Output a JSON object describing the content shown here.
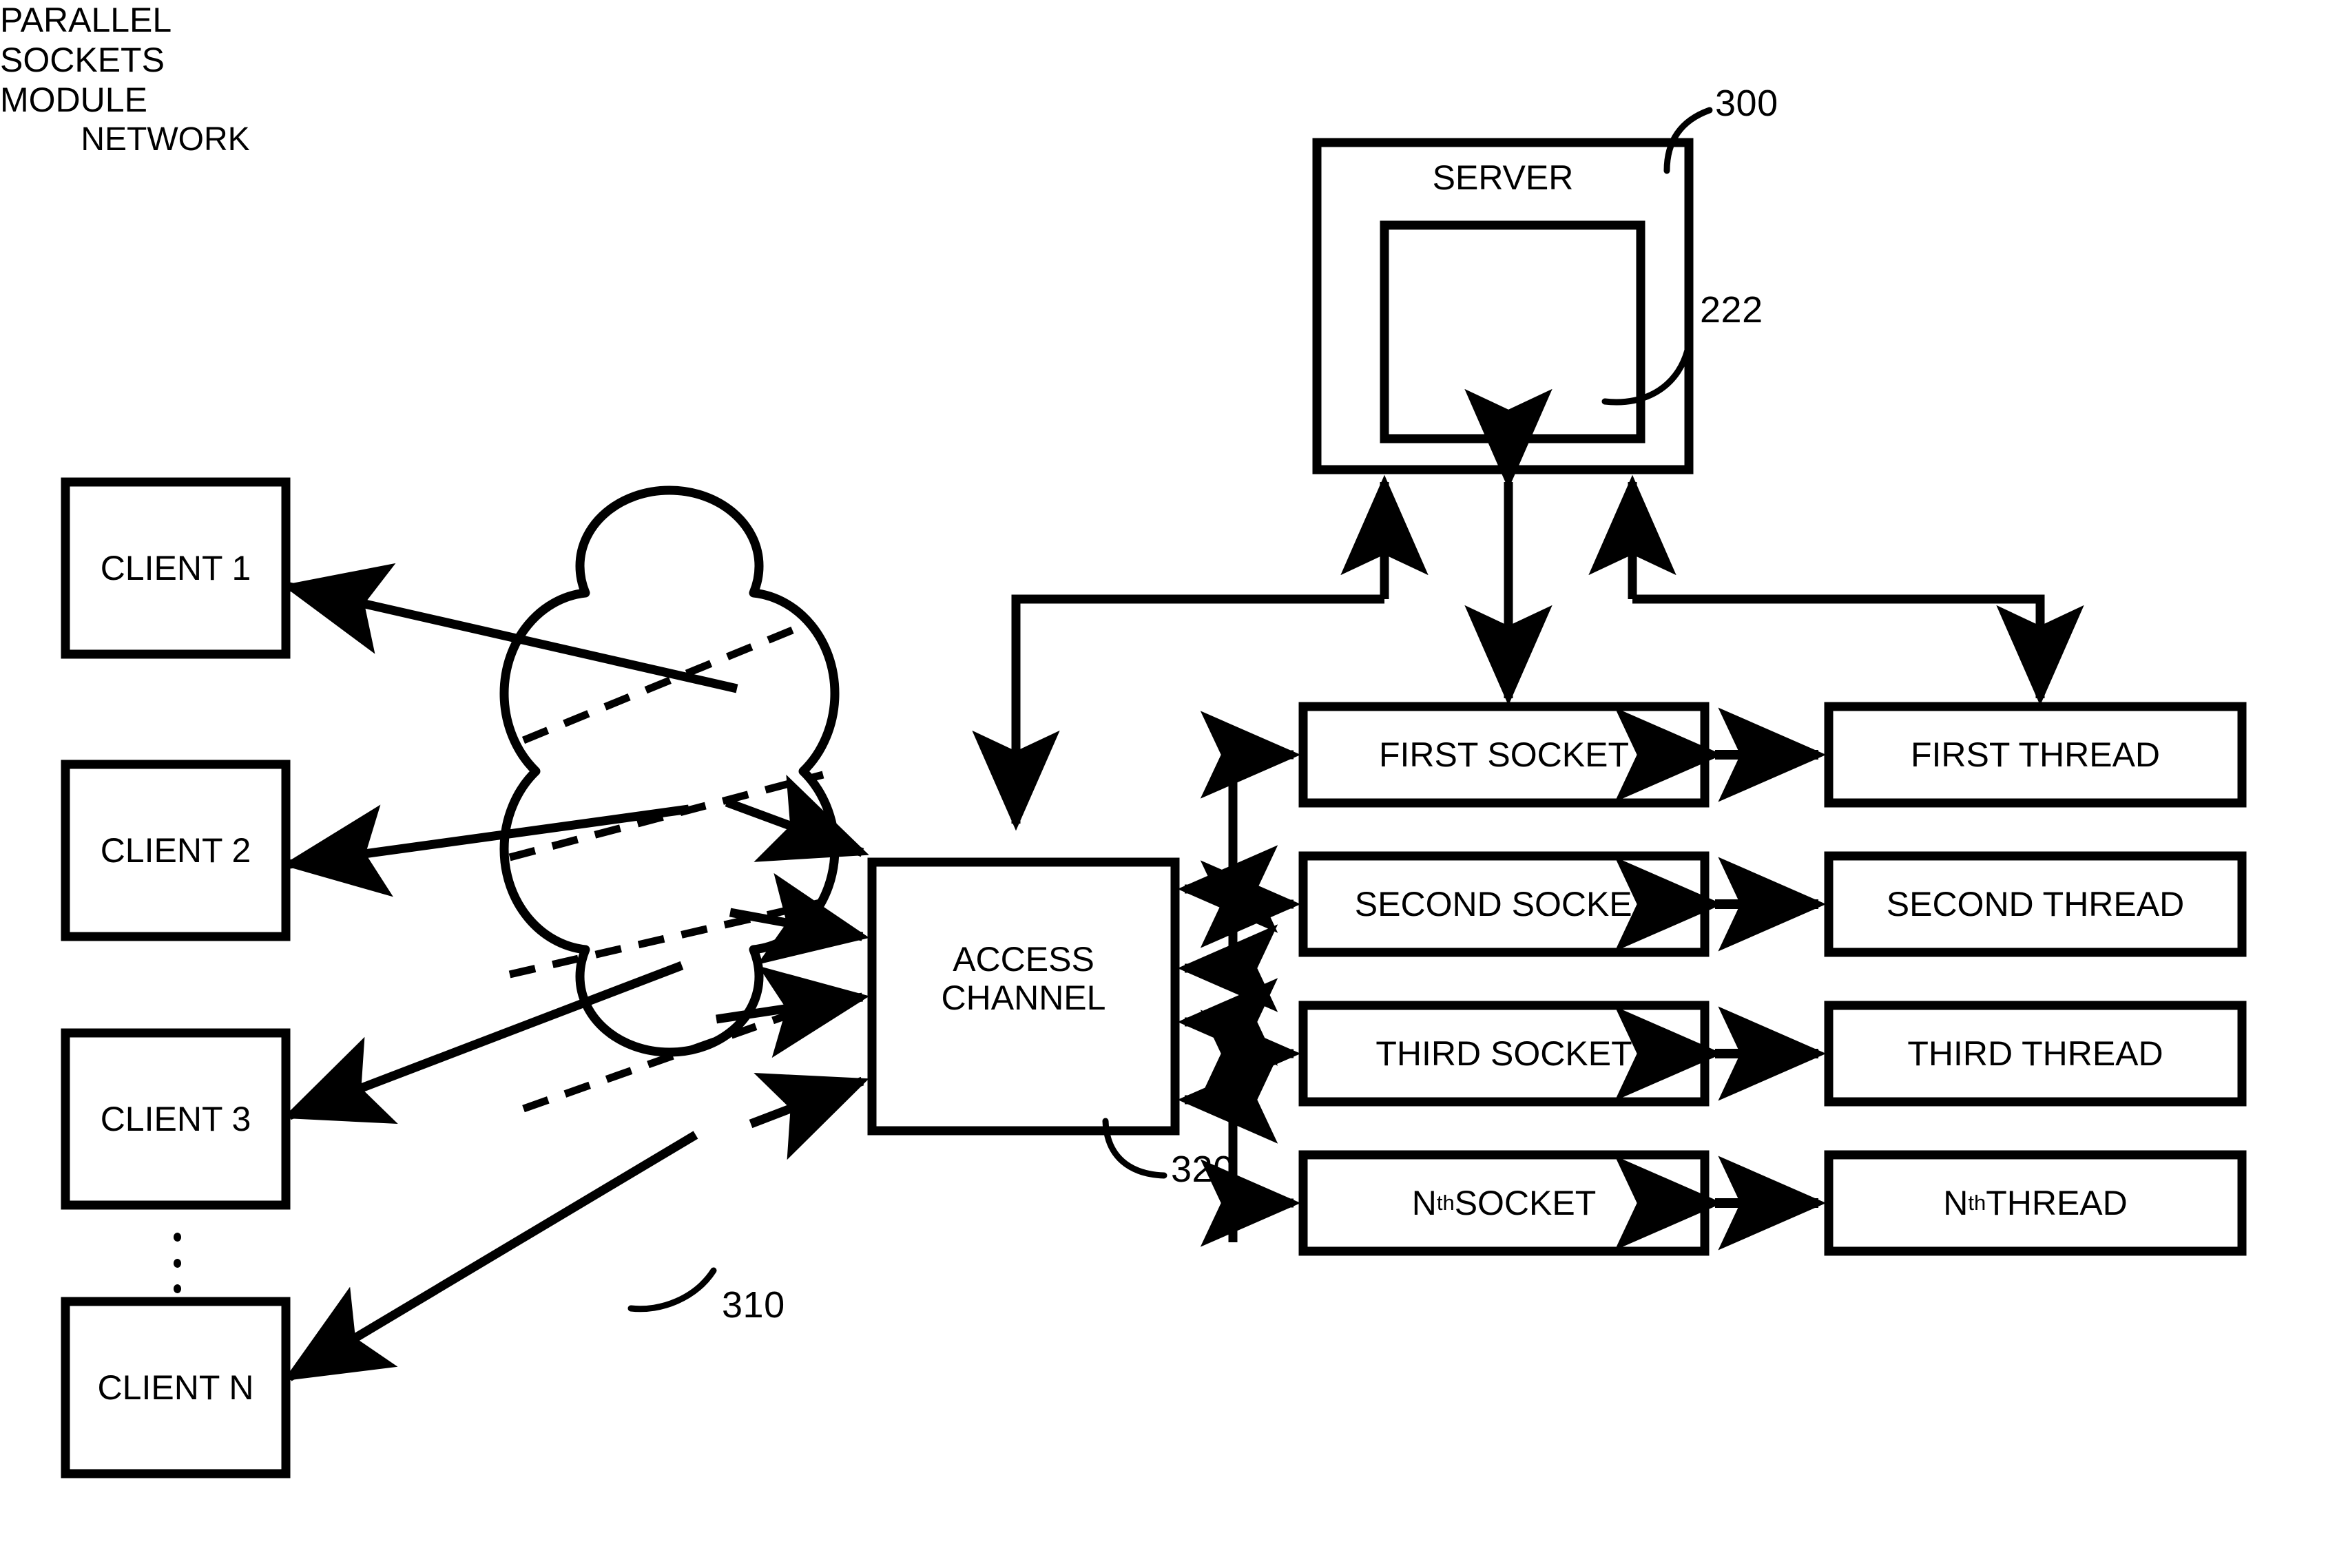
{
  "figure": {
    "reference_numbers": {
      "server": "300",
      "parallel_sockets_module": "222",
      "network": "310",
      "access_channel": "320"
    },
    "server": {
      "title": "SERVER",
      "module_line1": "PARALLEL",
      "module_line2": "SOCKETS",
      "module_line3": "MODULE"
    },
    "network": {
      "label": "NETWORK"
    },
    "access_channel": {
      "line1": "ACCESS",
      "line2": "CHANNEL"
    },
    "clients": [
      {
        "label": "CLIENT 1"
      },
      {
        "label": "CLIENT 2"
      },
      {
        "label": "CLIENT 3"
      },
      {
        "label": "CLIENT N"
      }
    ],
    "client_ellipsis": "⋮",
    "sockets": [
      {
        "label": "FIRST SOCKET",
        "prefix": "",
        "sup": "",
        "suffix": ""
      },
      {
        "label": "SECOND SOCKET",
        "prefix": "",
        "sup": "",
        "suffix": ""
      },
      {
        "label": "THIRD SOCKET",
        "prefix": "",
        "sup": "",
        "suffix": ""
      },
      {
        "label": "",
        "prefix": "N",
        "sup": "th",
        "suffix": " SOCKET"
      }
    ],
    "threads": [
      {
        "label": "FIRST THREAD",
        "prefix": "",
        "sup": "",
        "suffix": ""
      },
      {
        "label": "SECOND THREAD",
        "prefix": "",
        "sup": "",
        "suffix": ""
      },
      {
        "label": "THIRD THREAD",
        "prefix": "",
        "sup": "",
        "suffix": ""
      },
      {
        "label": "",
        "prefix": "N",
        "sup": "th",
        "suffix": " THREAD"
      }
    ],
    "colors": {
      "ink": "#000000",
      "paper": "#ffffff"
    }
  }
}
